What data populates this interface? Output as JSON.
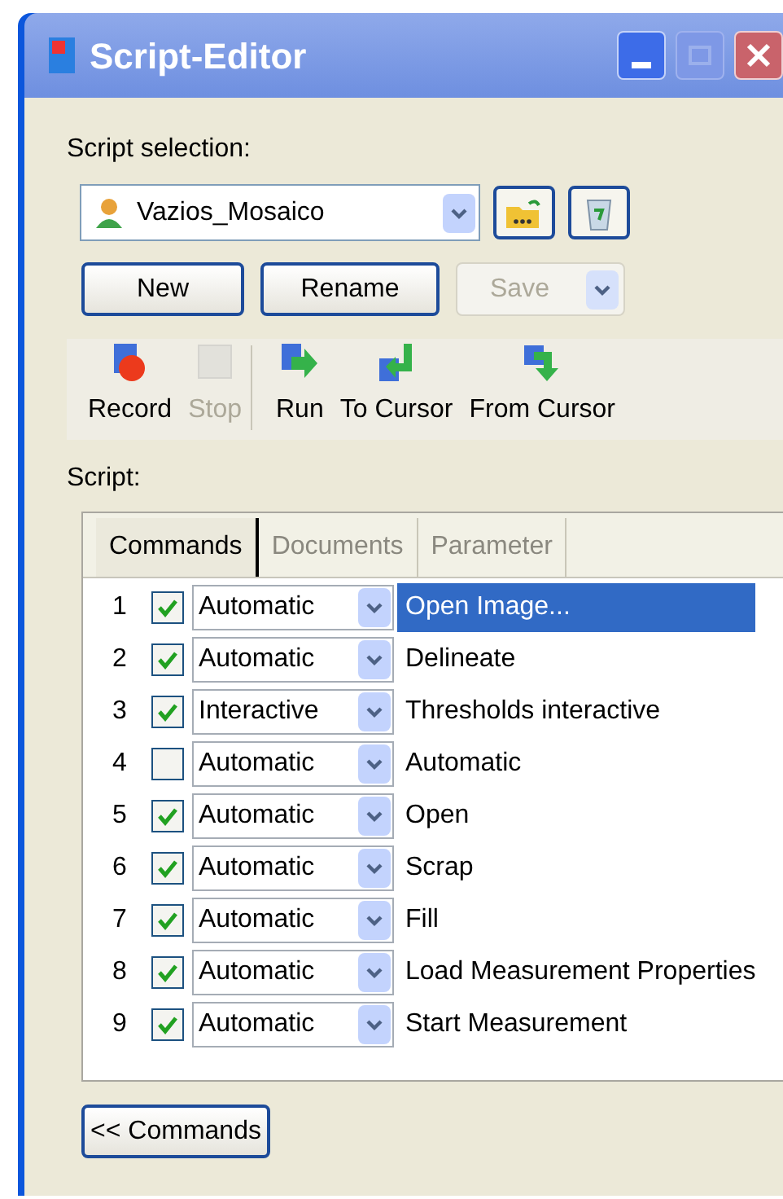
{
  "window": {
    "title": "Script-Editor"
  },
  "script_selection": {
    "label": "Script selection:",
    "value": "Vazios_Mosaico"
  },
  "buttons": [
    {
      "label": "New",
      "disabled": false
    },
    {
      "label": "Rename",
      "disabled": false
    }
  ],
  "save_button": {
    "label": "Save",
    "disabled": true
  },
  "toolbar": [
    {
      "label": "Record",
      "disabled": false,
      "kind": "record"
    },
    {
      "label": "Stop",
      "disabled": true,
      "kind": "stop"
    },
    {
      "label": "Run",
      "disabled": false,
      "kind": "run"
    },
    {
      "label": "To Cursor",
      "disabled": false,
      "kind": "to-cursor"
    },
    {
      "label": "From Cursor",
      "disabled": false,
      "kind": "from-cursor"
    }
  ],
  "script_label": "Script:",
  "tabs": [
    {
      "label": "Commands",
      "selected": true
    },
    {
      "label": "Documents",
      "selected": false
    },
    {
      "label": "Parameter",
      "selected": false
    }
  ],
  "commands": [
    {
      "number": "1",
      "checked": true,
      "mode": "Automatic",
      "name": "Open Image...",
      "selected": true
    },
    {
      "number": "2",
      "checked": true,
      "mode": "Automatic",
      "name": "Delineate",
      "selected": false
    },
    {
      "number": "3",
      "checked": true,
      "mode": "Interactive",
      "name": "Thresholds interactive",
      "selected": false
    },
    {
      "number": "4",
      "checked": false,
      "mode": "Automatic",
      "name": "Automatic",
      "selected": false
    },
    {
      "number": "5",
      "checked": true,
      "mode": "Automatic",
      "name": "Open",
      "selected": false
    },
    {
      "number": "6",
      "checked": true,
      "mode": "Automatic",
      "name": "Scrap",
      "selected": false
    },
    {
      "number": "7",
      "checked": true,
      "mode": "Automatic",
      "name": "Fill",
      "selected": false
    },
    {
      "number": "8",
      "checked": true,
      "mode": "Automatic",
      "name": "Load Measurement Properties",
      "selected": false
    },
    {
      "number": "9",
      "checked": true,
      "mode": "Automatic",
      "name": "Start Measurement",
      "selected": false
    }
  ],
  "commands_button": "<< Commands"
}
